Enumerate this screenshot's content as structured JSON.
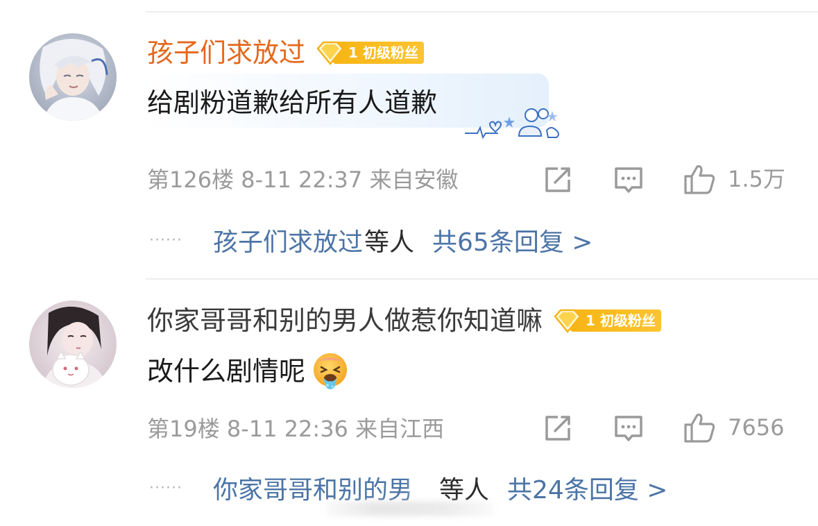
{
  "comments": [
    {
      "username": "孩子们求放过",
      "badge_level": "1",
      "badge_label": "初级粉丝",
      "text": "给剧粉道歉给所有人道歉",
      "floor_meta": "第126楼  8-11 22:37  来自安徽",
      "likes": "1.5万",
      "reply_preview_name": "孩子们求放过",
      "reply_preview_suffix": "等人",
      "reply_count_text": "共65条回复 >",
      "colors": {
        "username": "#e5681c"
      }
    },
    {
      "username": "你家哥哥和别的男人做惹你知道嘛",
      "badge_level": "1",
      "badge_label": "初级粉丝",
      "text": "改什么剧情呢",
      "floor_meta": "第19楼  8-11 22:36  来自江西",
      "likes": "7656",
      "reply_preview_name": "你家哥哥和别的男",
      "reply_preview_suffix": "等人",
      "reply_count_text": "共24条回复 >",
      "colors": {
        "username": "#3a3a3a"
      }
    }
  ],
  "ellipsis": "······",
  "icons": {
    "repost": "repost-icon",
    "comment": "comment-icon",
    "like": "thumbs-up-icon",
    "badge": "diamond-badge-icon",
    "emoji": "vomiting-face-emoji",
    "bubble_decoration": "bubble-decoration"
  },
  "theme": {
    "link_blue": "#4c74a6",
    "meta_gray": "#9a9a9a",
    "badge_gold": "#f7b514",
    "divider": "#eeeeee"
  }
}
